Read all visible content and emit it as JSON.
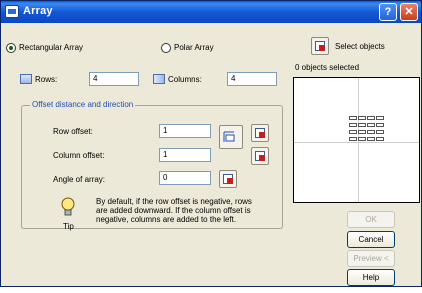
{
  "window": {
    "title": "Array"
  },
  "titlebar": {
    "help_label": "?",
    "close_label": "✕"
  },
  "mode": {
    "rectangular_label": "Rectangular Array",
    "polar_label": "Polar Array",
    "selected": "rectangular"
  },
  "select": {
    "button_label": "Select objects",
    "status": "0 objects selected"
  },
  "grid": {
    "rows_label": "Rows:",
    "rows_value": "4",
    "columns_label": "Columns:",
    "columns_value": "4"
  },
  "offset": {
    "group_label": "Offset distance and direction",
    "row_label": "Row offset:",
    "row_value": "1",
    "column_label": "Column offset:",
    "column_value": "1",
    "angle_label": "Angle of array:",
    "angle_value": "0"
  },
  "tip": {
    "label": "Tip",
    "text": "By default, if the row offset is negative, rows are added downward. If the column offset is negative, columns are added to the left."
  },
  "buttons": {
    "ok": "OK",
    "cancel": "Cancel",
    "preview": "Preview <",
    "help": "Help"
  },
  "icons": [
    "app-icon",
    "help-icon",
    "close-icon",
    "rows-icon",
    "columns-icon",
    "pick-both-offsets-icon",
    "pick-row-offset-icon",
    "pick-column-offset-icon",
    "pick-angle-icon",
    "select-objects-icon",
    "tip-lightbulb-icon"
  ],
  "colors": {
    "titlebar": "#0d47c2",
    "dialog_bg": "#ece9d8",
    "close": "#c33f1b",
    "group_label": "#1f4fb5"
  }
}
